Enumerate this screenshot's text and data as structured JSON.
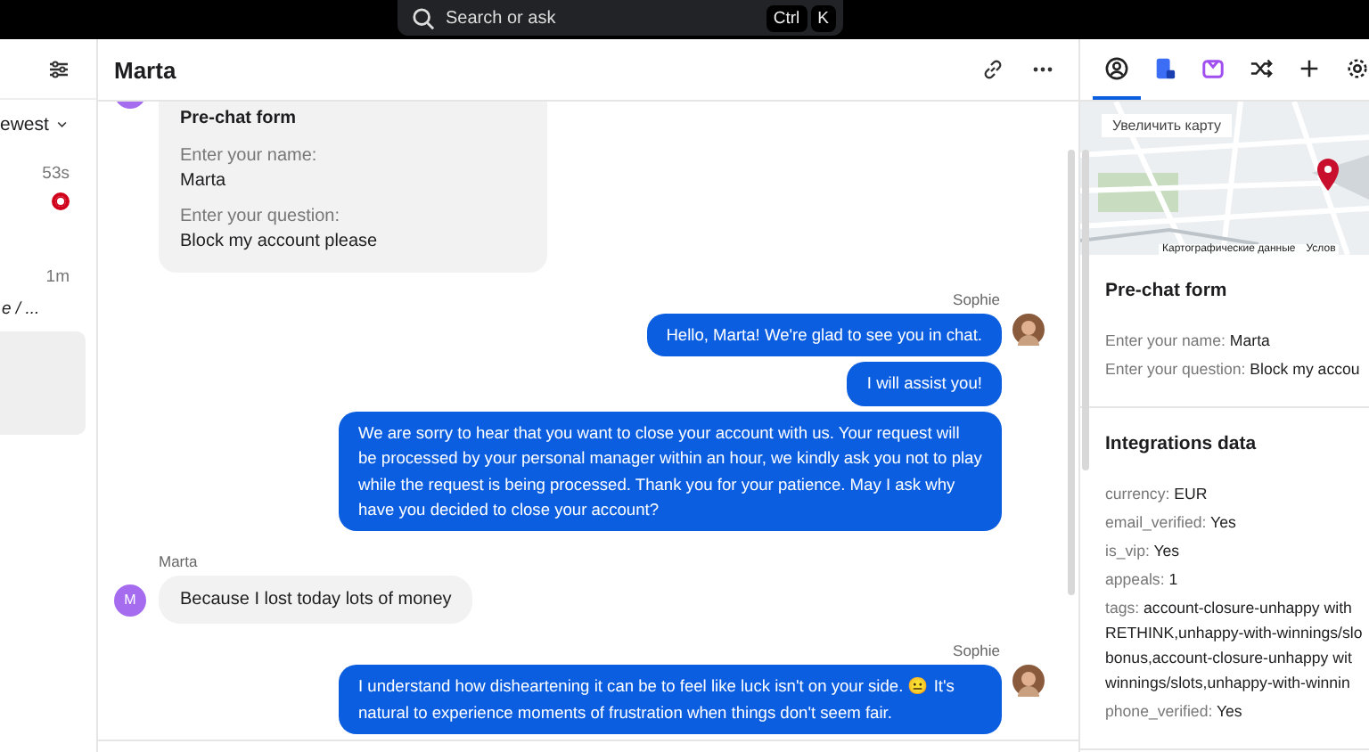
{
  "search": {
    "placeholder": "Search or ask",
    "keys": [
      "Ctrl",
      "K"
    ]
  },
  "inbox": {
    "sort": "ewest",
    "items": [
      {
        "time": "53s",
        "unread": true
      },
      {
        "time": "1m",
        "unread": false,
        "preview": "e / ..."
      }
    ]
  },
  "chat": {
    "title": "Marta",
    "messages": [
      {
        "kind": "form",
        "title": "Pre-chat form",
        "fields": [
          {
            "label": "Enter your name:",
            "value": "Marta"
          },
          {
            "label": "Enter your question:",
            "value": "Block my account please"
          }
        ]
      },
      {
        "kind": "agent",
        "sender": "Sophie",
        "parts": [
          "Hello, Marta! We're glad to see you in chat.",
          "I will assist you!",
          "We are sorry to hear that you want to close your account with us. Your request will be processed by your personal manager within an hour, we kindly ask you not to play while the request is being processed. Thank you for your patience. May I ask why have you decided to close your account?"
        ]
      },
      {
        "kind": "customer",
        "sender": "Marta",
        "initial": "M",
        "parts": [
          "Because I lost today lots of money"
        ]
      },
      {
        "kind": "agent",
        "sender": "Sophie",
        "parts": [
          "I understand how disheartening it can be to feel like luck isn't on your side. 😐 It's natural to experience moments of frustration when things don't seem fair."
        ]
      }
    ]
  },
  "details": {
    "tabs": [
      {
        "kind": "person",
        "selected": true
      },
      {
        "kind": "doc",
        "selected": false
      },
      {
        "kind": "box",
        "selected": false
      },
      {
        "kind": "shuffle",
        "selected": false
      },
      {
        "kind": "plus",
        "selected": false
      },
      {
        "kind": "gear",
        "selected": false
      }
    ],
    "map": {
      "kind": "picture",
      "zoom_button": "Увеличить карту",
      "attribution": "Картографические данные",
      "terms": "Услов"
    },
    "prechat": {
      "title": "Pre-chat form",
      "rows": [
        {
          "key": "Enter your name:",
          "value": "Marta"
        },
        {
          "key": "Enter your question:",
          "value": "Block my accou"
        }
      ]
    },
    "integrations": {
      "title": "Integrations data",
      "rows": [
        {
          "key": "currency:",
          "lines": [
            "EUR"
          ]
        },
        {
          "key": "email_verified:",
          "lines": [
            "Yes"
          ]
        },
        {
          "key": "is_vip:",
          "lines": [
            "Yes"
          ]
        },
        {
          "key": "appeals:",
          "lines": [
            "1"
          ]
        },
        {
          "key": "tags:",
          "lines": [
            "account-closure-unhappy with",
            "RETHINK,unhappy-with-winnings/slo",
            "bonus,account-closure-unhappy wit",
            "winnings/slots,unhappy-with-winnin"
          ]
        },
        {
          "key": "phone_verified:",
          "lines": [
            "Yes"
          ]
        }
      ]
    }
  }
}
